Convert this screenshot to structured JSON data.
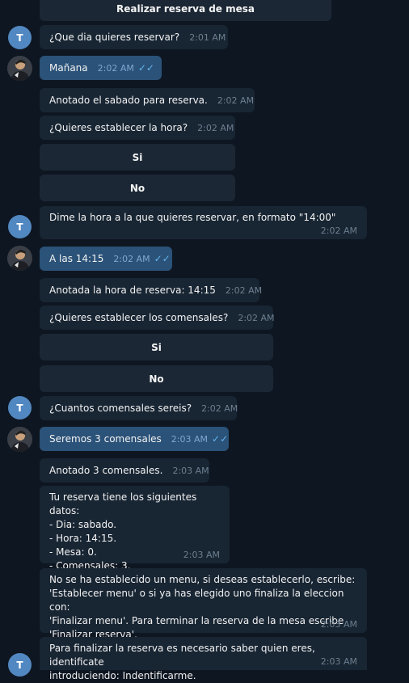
{
  "keyboard": {
    "realizar": "Realizar reserva de mesa",
    "si": "Si",
    "no": "No"
  },
  "avatars": {
    "bot_letter": "T",
    "user_icon": "user-photo"
  },
  "messages": {
    "m1": {
      "text": "¿Que dia quieres reservar?",
      "time": "2:01 AM"
    },
    "m2": {
      "text": "Mañana",
      "time": "2:02 AM"
    },
    "m3": {
      "text": "Anotado el sabado para reserva.",
      "time": "2:02 AM"
    },
    "m4": {
      "text": "¿Quieres establecer la hora?",
      "time": "2:02 AM"
    },
    "m5": {
      "text": "Dime la hora a la que quieres reservar, en formato \"14:00\"",
      "time": "2:02 AM"
    },
    "m6": {
      "text": "A las 14:15",
      "time": "2:02 AM"
    },
    "m7": {
      "text": "Anotada la hora de reserva: 14:15",
      "time": "2:02 AM"
    },
    "m8": {
      "text": "¿Quieres establecer los comensales?",
      "time": "2:02 AM"
    },
    "m9": {
      "text": "¿Cuantos comensales sereis?",
      "time": "2:02 AM"
    },
    "m10": {
      "text": "Seremos 3 comensales",
      "time": "2:03 AM"
    },
    "m11": {
      "text": "Anotado 3 comensales.",
      "time": "2:03 AM"
    },
    "m12": {
      "lines": [
        "Tu reserva tiene los siguientes datos:",
        "- Dia: sabado.",
        "- Hora: 14:15.",
        "- Mesa: 0.",
        "- Comensales: 3."
      ],
      "time": "2:03 AM"
    },
    "m13": {
      "lines": [
        "No se ha establecido un menu, si deseas establecerlo, escribe:",
        "'Establecer menu' o si ya has elegido uno finaliza la eleccion con:",
        "'Finalizar menu'. Para terminar la reserva de la mesa escribe",
        "'Finalizar reserva'."
      ],
      "time": "2:03 AM"
    },
    "m14": {
      "lines": [
        "Para finalizar la reserva es necesario saber quien eres, identificate",
        "introduciendo: Indentificarme."
      ],
      "time": "2:03 AM"
    }
  },
  "colors": {
    "background": "#0e1621",
    "incoming_bubble": "#182533",
    "outgoing_bubble": "#2b5278",
    "keyboard_button": "#1b2735",
    "bot_avatar": "#5288c1",
    "read_ticks": "#64b5ef"
  }
}
